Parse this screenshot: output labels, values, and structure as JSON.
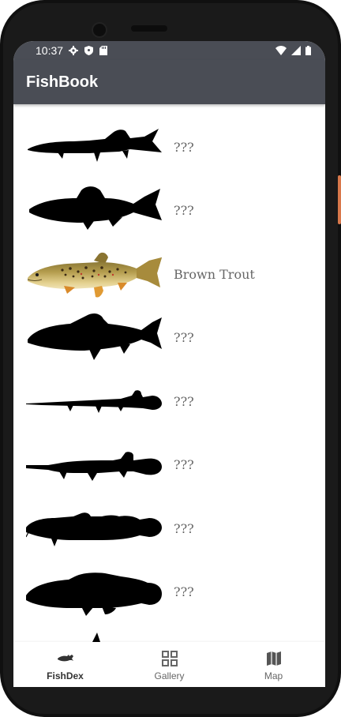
{
  "status_bar": {
    "time": "10:37"
  },
  "app_bar": {
    "title": "FishBook"
  },
  "fish_list": [
    {
      "name": "???",
      "silhouette": "pike"
    },
    {
      "name": "???",
      "silhouette": "trout"
    },
    {
      "name": "Brown Trout",
      "silhouette": "brown-trout-photo"
    },
    {
      "name": "???",
      "silhouette": "bass"
    },
    {
      "name": "???",
      "silhouette": "needlefish"
    },
    {
      "name": "???",
      "silhouette": "gar"
    },
    {
      "name": "???",
      "silhouette": "catfish"
    },
    {
      "name": "???",
      "silhouette": "bowfin"
    },
    {
      "name": "",
      "silhouette": "partial"
    }
  ],
  "bottom_nav": {
    "items": [
      {
        "label": "FishDex",
        "icon": "fish-icon",
        "active": true
      },
      {
        "label": "Gallery",
        "icon": "grid-icon",
        "active": false
      },
      {
        "label": "Map",
        "icon": "map-icon",
        "active": false
      }
    ]
  },
  "colors": {
    "app_bar": "#4a4d55",
    "silhouette": "#000000",
    "label_text": "#666666"
  }
}
